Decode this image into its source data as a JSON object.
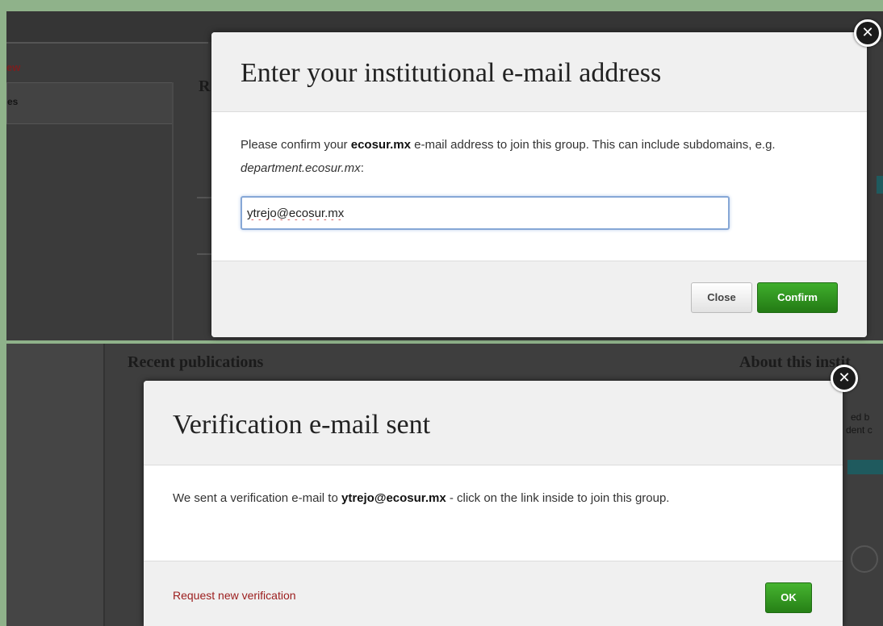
{
  "top_background": {
    "sidebar_text_red": "ew",
    "sidebar_text": "es",
    "heading_fragment": "R"
  },
  "bottom_background": {
    "recent_publications": "Recent publications",
    "about_institution": "About this instit",
    "side_text_1": "ed b",
    "side_text_2": "dent c"
  },
  "email_dialog": {
    "title": "Enter your institutional e-mail address",
    "body_prefix": "Please confirm your ",
    "body_domain": "ecosur.mx",
    "body_middle": " e-mail address to join this group. This can include subdomains, e.g. ",
    "body_example": "department.ecosur.mx",
    "body_suffix": ":",
    "input_value": "ytrejo@ecosur.mx",
    "close_label": "Close",
    "confirm_label": "Confirm",
    "dismiss_glyph": "✕"
  },
  "verify_dialog": {
    "title": "Verification e-mail sent",
    "body_prefix": "We sent a verification e-mail to ",
    "body_email": "ytrejo@ecosur.mx",
    "body_suffix": " - click on the link inside to join this group.",
    "request_link": "Request new verification",
    "ok_label": "OK",
    "dismiss_glyph": "✕"
  },
  "colors": {
    "frame_green": "#8fb28a",
    "confirm_green": "#2e9620",
    "link_red": "#9b1c1c",
    "input_focus": "#86a7d6"
  }
}
